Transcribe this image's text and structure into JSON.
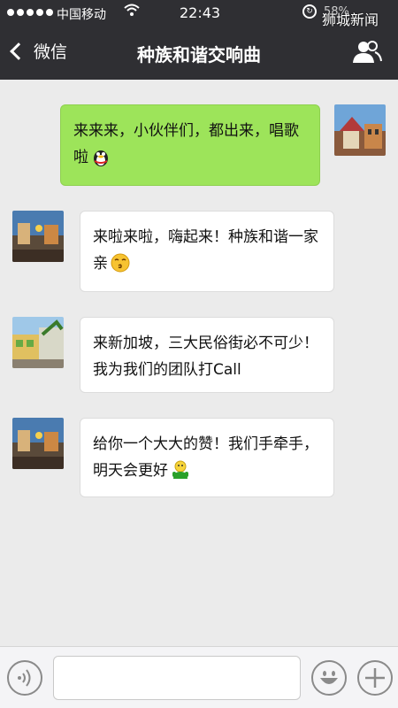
{
  "status_bar": {
    "carrier": "中国移动",
    "time": "22:43",
    "battery": "58%",
    "watermark": "狮城新闻"
  },
  "nav": {
    "back_label": "微信",
    "title": "种族和谐交响曲"
  },
  "messages": [
    {
      "sender": "me",
      "text": "来来来，小伙伴们，都出来，唱歌啦",
      "emoji": "penguin-emoji"
    },
    {
      "sender": "other",
      "text": "来啦来啦，嗨起来！种族和谐一家亲",
      "emoji": "kiss-face-emoji"
    },
    {
      "sender": "other",
      "text": "来新加坡，三大民俗街必不可少！我为我们的团队打Call",
      "emoji": ""
    },
    {
      "sender": "other",
      "text": "给你一个大大的赞！我们手牵手，明天会更好",
      "emoji": "thumbs-up-person-emoji"
    }
  ],
  "colors": {
    "header_bg": "#2f2f33",
    "chat_bg": "#ebebeb",
    "my_bubble": "#9de45a",
    "other_bubble": "#ffffff"
  },
  "icons": [
    "back-chevron-icon",
    "people-icon",
    "voice-icon",
    "emoji-icon",
    "plus-icon",
    "wifi-icon",
    "lock-rotation-icon"
  ]
}
